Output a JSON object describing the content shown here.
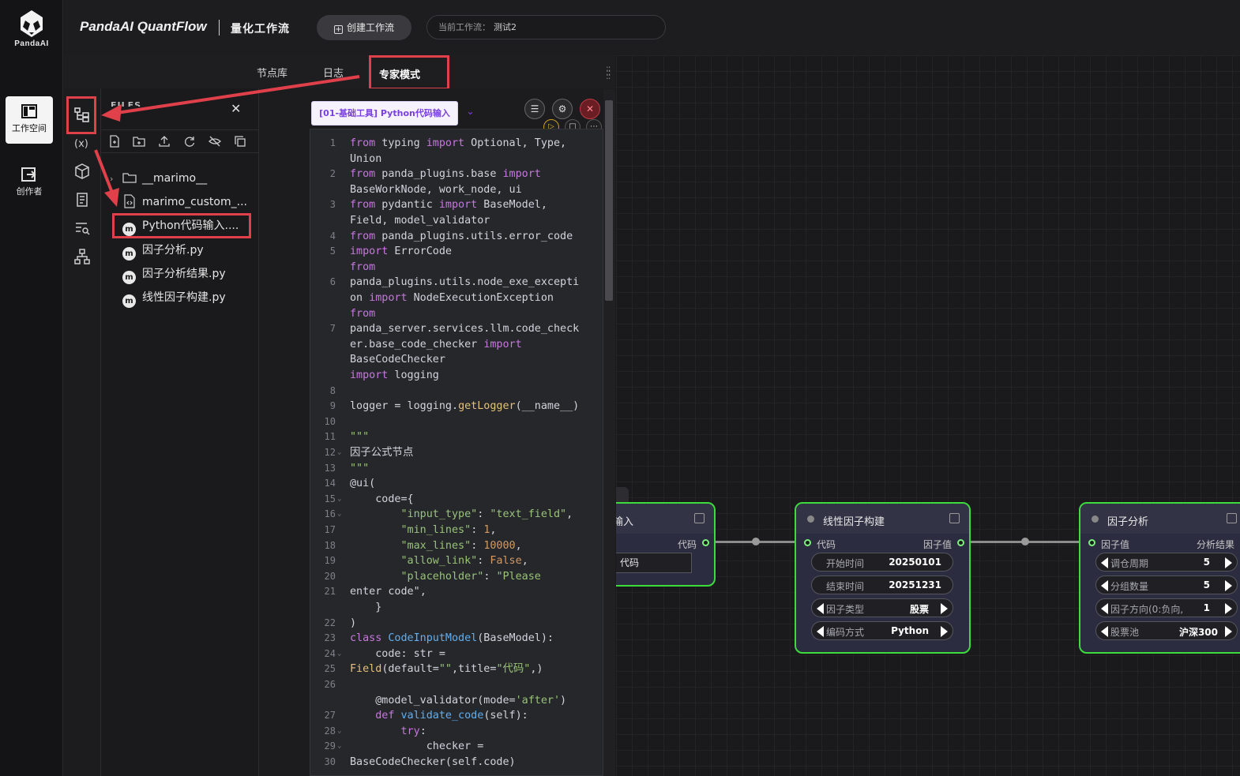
{
  "rail": {
    "logo_text": "PandaAI",
    "items": [
      {
        "label": "工作空间"
      },
      {
        "label": "创作者"
      }
    ]
  },
  "header": {
    "app_title": "PandaAI QuantFlow",
    "app_subtitle": "量化工作流",
    "create_button": "创建工作流",
    "current_workflow_label": "当前工作流：",
    "current_workflow_value": "测试2"
  },
  "tabs": [
    {
      "label": "节点库"
    },
    {
      "label": "日志"
    },
    {
      "label": "专家模式",
      "active": true
    }
  ],
  "files_panel": {
    "title": "FILES",
    "items": [
      {
        "name": "__marimo__",
        "type": "folder"
      },
      {
        "name": "marimo_custom_...",
        "type": "code"
      },
      {
        "name": "Python代码输入....",
        "type": "marimo",
        "selected": true
      },
      {
        "name": "因子分析.py",
        "type": "marimo"
      },
      {
        "name": "因子分析结果.py",
        "type": "marimo"
      },
      {
        "name": "线性因子构建.py",
        "type": "marimo"
      }
    ]
  },
  "editor": {
    "cell_name": "[01-基础工具] Python代码输入",
    "line_numbers": [
      "1",
      "2",
      "3",
      "4",
      "5",
      "6",
      "7",
      "8",
      "9",
      "10",
      "11",
      "12",
      "13",
      "14",
      "15",
      "16",
      "17",
      "18",
      "19",
      "20",
      "21",
      "22",
      "23",
      "24",
      "25",
      "26",
      "27",
      "28",
      "29",
      "30"
    ],
    "lines": [
      [
        "from",
        " typing ",
        "import",
        " Optional, Type,"
      ],
      [
        "Union"
      ],
      [
        "from",
        " panda_plugins.base ",
        "import"
      ],
      [
        "BaseWorkNode, work_node, ui"
      ],
      [
        "from",
        " pydantic ",
        "import",
        " BaseModel,"
      ],
      [
        "Field, model_validator"
      ],
      [
        "from",
        " panda_plugins.utils.error_code"
      ],
      [
        "import",
        " ErrorCode"
      ],
      [
        "from"
      ],
      [
        "panda_plugins.utils.node_exe_excepti"
      ],
      [
        "on ",
        "import",
        " NodeExecutionException"
      ],
      [
        "from"
      ],
      [
        "panda_server.services.llm.code_check"
      ],
      [
        "er.base_code_checker ",
        "import"
      ],
      [
        "BaseCodeChecker"
      ],
      [
        "import",
        " logging"
      ],
      [
        "logger = logging.",
        "getLogger",
        "(__name__)"
      ],
      [
        "\"\"\""
      ],
      [
        "因子公式节点"
      ],
      [
        "\"\"\""
      ],
      [
        "@ui("
      ],
      [
        "    code={"
      ],
      [
        "        ",
        "\"input_type\"",
        ": ",
        "\"text_field\"",
        ","
      ],
      [
        "        ",
        "\"min_lines\"",
        ": ",
        "1",
        ","
      ],
      [
        "        ",
        "\"max_lines\"",
        ": ",
        "10000",
        ","
      ],
      [
        "        ",
        "\"allow_link\"",
        ": ",
        "False",
        ","
      ],
      [
        "        ",
        "\"placeholder\"",
        ": ",
        "\"Please"
      ],
      [
        "enter code\"",
        ","
      ],
      [
        "    }"
      ],
      [
        ")"
      ],
      [
        "class",
        " ",
        "CodeInputModel",
        "(BaseModel):"
      ],
      [
        "    code: str ="
      ],
      [
        "Field",
        "(default=",
        "\"\"",
        ",title=",
        "\"代码\"",
        ",)"
      ],
      [
        "    @model_validator(mode=",
        "'after'",
        ")"
      ],
      [
        "    ",
        "def",
        " ",
        "validate_code",
        "(self):"
      ],
      [
        "        ",
        "try",
        ":"
      ],
      [
        "            checker ="
      ],
      [
        "BaseCodeChecker(self.code)"
      ]
    ]
  },
  "nodes": [
    {
      "title": "输入",
      "port_out": "代码",
      "field_value": "代码"
    },
    {
      "title": "线性因子构建",
      "port_in": "代码",
      "port_out": "因子值",
      "params": [
        {
          "key": "开始时间",
          "value": "20250101"
        },
        {
          "key": "结束时间",
          "value": "20251231"
        },
        {
          "key": "因子类型",
          "value": "股票"
        },
        {
          "key": "编码方式",
          "value": "Python"
        }
      ]
    },
    {
      "title": "因子分析",
      "port_in": "因子值",
      "port_out": "分析结果",
      "params": [
        {
          "key": "调仓周期",
          "value": "5"
        },
        {
          "key": "分组数量",
          "value": "5"
        },
        {
          "key": "因子方向(0:负向,",
          "value": "1"
        },
        {
          "key": "股票池",
          "value": "沪深300"
        }
      ]
    }
  ],
  "colors": {
    "highlight": "#e0404a",
    "node_border": "#3ddc3d",
    "keyword": "#c678dd",
    "string": "#98c379"
  }
}
